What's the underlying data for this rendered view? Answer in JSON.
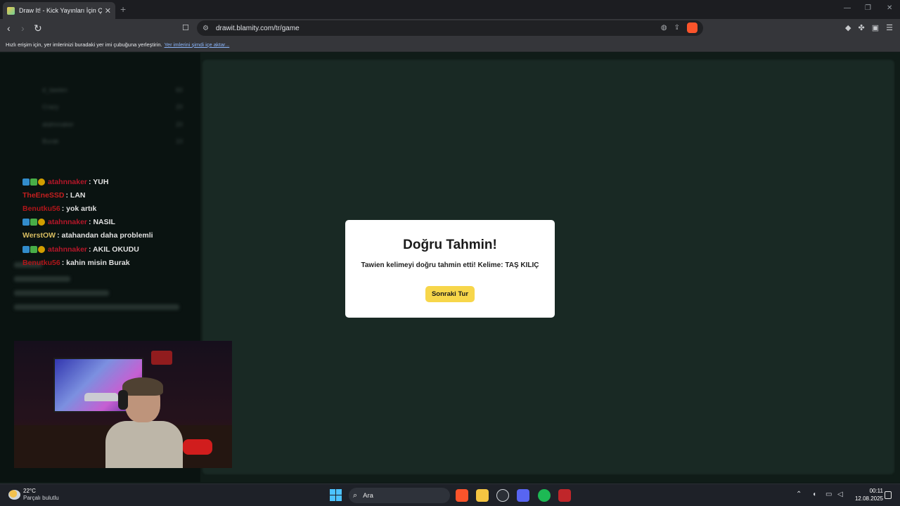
{
  "browser": {
    "tab_title": "Draw It! - Kick Yayınları İçin Ç",
    "tab_close": "✕",
    "new_tab": "+",
    "url": "drawit.blamity.com/tr/game",
    "bookmark_bar_message": "Hızlı erişim için, yer imlerinizi buradaki yer imi çubuğuna yerleştirin.",
    "bookmark_bar_link": "Yer imlerini şimdi içe aktar..."
  },
  "sidebar": {
    "players": [
      {
        "name": "d_tawien",
        "score": "60"
      },
      {
        "name": "Crazy",
        "score": "20"
      },
      {
        "name": "atahnnaker",
        "score": "20"
      },
      {
        "name": "Burak",
        "score": "10"
      }
    ]
  },
  "chat": {
    "lines": [
      {
        "user": "atahnnaker",
        "user_color": "#d01a2f",
        "badges": true,
        "message": ": YUH"
      },
      {
        "user": "TheEneSSD",
        "user_color": "#e02424",
        "badges": false,
        "message": ": LAN"
      },
      {
        "user": "Benutku56",
        "user_color": "#c8191e",
        "badges": false,
        "message": ": yok artık"
      },
      {
        "user": "atahnnaker",
        "user_color": "#d01a2f",
        "badges": true,
        "message": ": NASIL"
      },
      {
        "user": "WerstOW",
        "user_color": "#f5d76e",
        "badges": false,
        "message": ": atahandan daha problemli"
      },
      {
        "user": "atahnnaker",
        "user_color": "#d01a2f",
        "badges": true,
        "message": ": AKIL OKUDU"
      },
      {
        "user": "Benutku56",
        "user_color": "#c8191e",
        "badges": false,
        "message": ": kahin misin Burak"
      }
    ]
  },
  "modal": {
    "title": "Doğru Tahmin!",
    "message": "Tawien kelimeyi doğru tahmin etti! Kelime: TAŞ KILIÇ",
    "button": "Sonraki Tur"
  },
  "taskbar": {
    "temperature": "22°C",
    "weather": "Parçalı bulutlu",
    "search_placeholder": "Ara",
    "time": "00:11",
    "date": "12.08.2025"
  },
  "colors": {
    "accent_button": "#f7d64a",
    "page_background": "#13201c"
  }
}
